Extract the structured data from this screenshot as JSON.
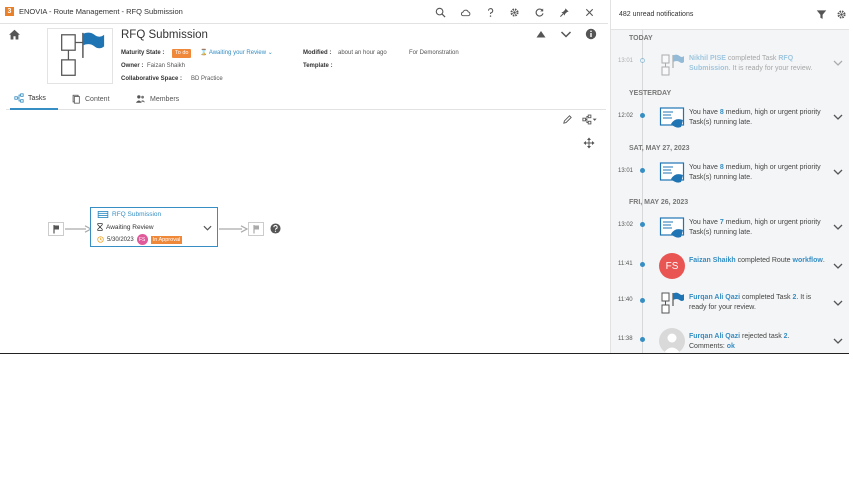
{
  "window": {
    "title": "ENOVIA - Route Management - RFQ Submission",
    "app_icon": "3"
  },
  "route": {
    "name": "RFQ Submission",
    "maturity_label": "Maturity State :",
    "maturity_badge": "To do",
    "maturity_link": "Awaiting your Review",
    "owner_label": "Owner :",
    "owner_value": "Faizan Shaikh",
    "space_label": "Collaborative Space :",
    "space_value": "BD Practice",
    "modified_label": "Modified :",
    "modified_value": "about an hour ago",
    "template_label": "Template :",
    "description": "For Demonstration"
  },
  "tabs": [
    {
      "label": "Tasks",
      "active": true
    },
    {
      "label": "Content",
      "active": false
    },
    {
      "label": "Members",
      "active": false
    }
  ],
  "task": {
    "title": "RFQ Submission",
    "status": "Awaiting Review",
    "date": "5/30/2023",
    "assignee_initials": "FS",
    "badge": "In Approval"
  },
  "notifications": {
    "count_text": "482 unread notifications",
    "sections": [
      {
        "label": "TODAY"
      },
      {
        "label": "YESTERDAY"
      },
      {
        "label": "SAT, MAY 27, 2023"
      },
      {
        "label": "FRI, MAY 26, 2023"
      }
    ],
    "items": [
      {
        "time": "13:01",
        "name": "Nikhil PISE",
        "middle": " completed Task ",
        "link": "RFQ Submission",
        "tail": ". It is ready for your review."
      },
      {
        "time": "12:02",
        "pre": "You have ",
        "num": "8",
        "tail": " medium, high or urgent priority Task(s) running late."
      },
      {
        "time": "13:01",
        "pre": "You have ",
        "num": "8",
        "tail": " medium, high or urgent priority Task(s) running late."
      },
      {
        "time": "13:02",
        "pre": "You have ",
        "num": "7",
        "tail": " medium, high or urgent priority Task(s) running late."
      },
      {
        "time": "11:41",
        "name": "Faizan Shaikh",
        "middle": " completed Route ",
        "link": "workflow",
        "tail": ".",
        "initials": "FS"
      },
      {
        "time": "11:40",
        "name": "Furqan Ali Qazi",
        "middle": " completed Task ",
        "link": "2",
        "tail": ". It is ready for your review."
      },
      {
        "time": "11:38",
        "name": "Furqan Ali Qazi",
        "middle": " rejected task ",
        "link": "2",
        "tail": ".",
        "comment_label": "Comments:",
        "comment": "ok"
      }
    ]
  },
  "colors": {
    "accent": "#368ec4",
    "badge_orange": "#f0883a",
    "avatar_red": "#e85552",
    "assignee_pink": "#e05a9b"
  }
}
